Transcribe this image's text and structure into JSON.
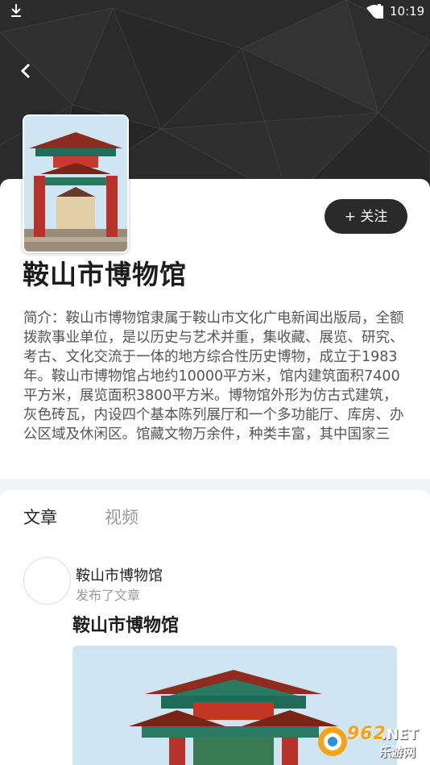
{
  "status_bar": {
    "time": "10:19"
  },
  "museum": {
    "name": "鞍山市博物馆",
    "follow_label": "+ 关注",
    "intro": "简介：鞍山市博物馆隶属于鞍山市文化广电新闻出版局，全额拨款事业单位，是以历史与艺术并重，集收藏、展览、研究、考古、文化交流于一体的地方综合性历史博物，成立于1983年。鞍山市博物馆占地约10000平方米，馆内建筑面积7400平方米，展览面积3800平方米。博物馆外形为仿古式建筑，灰色砖瓦，内设四个基本陈列展厅和一个多功能厅、库房、办公区域及休闲区。馆藏文物万余件，种类丰富，其中国家三"
  },
  "tabs": [
    {
      "label": "文章",
      "active": true
    },
    {
      "label": "视频",
      "active": false
    }
  ],
  "post": {
    "author": "鞍山市博物馆",
    "action": "发布了文章",
    "title": "鞍山市博物馆"
  },
  "watermark": {
    "number": "962",
    "suffix": ".NET",
    "sub": "乐游网"
  },
  "colors": {
    "header_bg": "#2b2b2b",
    "follow_button_bg": "#2a2a2a",
    "watermark_accent": "#f7a21b"
  },
  "icons": [
    "download-icon",
    "wifi-icon",
    "battery-icon",
    "back-arrow-icon"
  ]
}
